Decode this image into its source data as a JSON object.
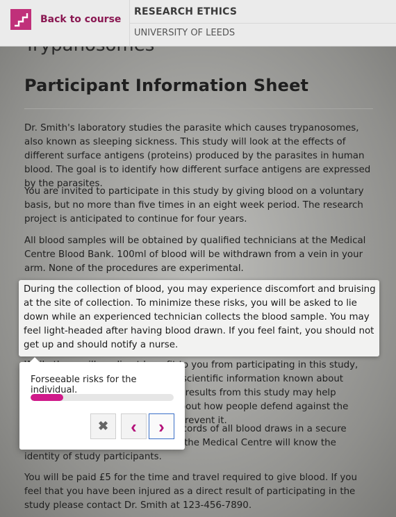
{
  "header": {
    "back_label": "Back to course",
    "course_title": "RESEARCH ETHICS",
    "institution": "UNIVERSITY OF LEEDS"
  },
  "page": {
    "partial_heading": "Trypanosomes",
    "title": "Participant Information Sheet",
    "paragraphs": [
      "Dr. Smith's laboratory studies the parasite which causes trypanosomes, also known as sleeping sickness. This study will look at the effects of different surface antigens (proteins) produced by the parasites in human blood. The goal is to identify how different surface antigens are expressed by the parasites.",
      "You are invited to participate in this study by giving blood on a voluntary basis, but no more than five times in an eight week period. The research project is anticipated to continue for four years.",
      "All blood samples will be obtained by qualified technicians at the Medical Centre Blood Bank. 100ml of blood will be withdrawn from a vein in your arm. None of the procedures are experimental.",
      "During the collection of blood, you may experience discomfort and bruising at the site of collection. To minimize these risks, you will be asked to lie down while an experienced technician collects the blood sample. You may feel light-headed after having blood drawn. If you feel faint, you should not get up and should notify a nurse.",
      "While there will no direct benefit to you from participating in this study, you will contribute to the body of scientific information known about sleeping sickness. In addition, the results from this study may help scientists and doctors will learn about how people defend against the disease and develop vaccines to prevent it.",
      "Dr. Smith's laboratory will keep records of all blood draws in a secure database. Only the technicians at the Medical Centre will know the identity of study participants.",
      "You will be paid £5 for the time and travel required to give blood. If you feel that you have been injured as a direct result of participating in the study please contact Dr. Smith at 123-456-7890."
    ]
  },
  "tour": {
    "step_text": "Forseeable risks for the individual.",
    "progress": 0.23,
    "buttons": {
      "close": "✖",
      "prev": "‹",
      "next": "›"
    }
  },
  "colors": {
    "accent": "#c0307a",
    "progress": "#d01a8a"
  }
}
